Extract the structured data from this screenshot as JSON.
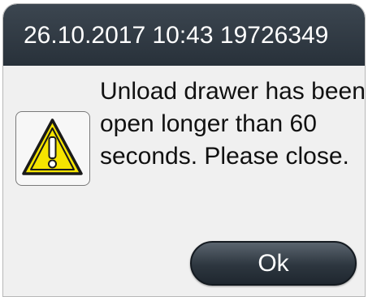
{
  "dialog": {
    "title": "26.10.2017 10:43 19726349",
    "message": "Unload drawer has been open longer than 60 seconds. Please close.",
    "icon": "warning-triangle-icon",
    "ok_label": "Ok"
  },
  "colors": {
    "titlebar": "#2f3842",
    "body_background": "#f0f0f0",
    "warning_yellow": "#f5e400",
    "button": "#2d363f"
  }
}
